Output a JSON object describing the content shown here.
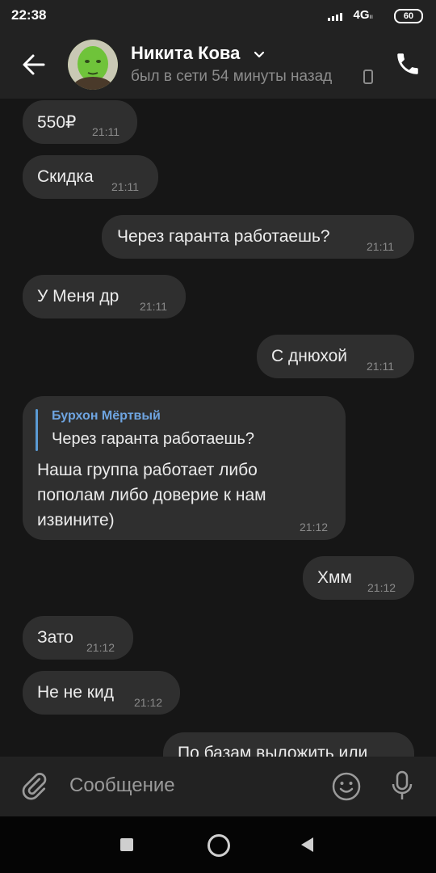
{
  "status_bar": {
    "time": "22:38",
    "network": "4G",
    "network_sub": "ıı",
    "battery": "60"
  },
  "header": {
    "contact_name": "Никита Кова",
    "presence": "был в сети 54 минуты назад"
  },
  "messages": [
    {
      "side": "in",
      "text": "550₽",
      "time": "21:11"
    },
    {
      "side": "in",
      "text": "Скидка",
      "time": "21:11"
    },
    {
      "side": "out",
      "text": "Через гаранта работаешь?",
      "time": "21:11"
    },
    {
      "side": "in",
      "text": "У Меня др",
      "time": "21:11"
    },
    {
      "side": "out",
      "text": "С днюхой",
      "time": "21:11"
    },
    {
      "side": "in",
      "reply_to_author": "Бурхон Мёртвый",
      "reply_to_text": "Через гаранта работаешь?",
      "text_lines": [
        "Наша группа работает либо",
        "пополам либо доверие к нам",
        "извините)"
      ],
      "time": "21:12"
    },
    {
      "side": "out",
      "text": "Хмм",
      "time": "21:12"
    },
    {
      "side": "in",
      "text": "Зато",
      "time": "21:12"
    },
    {
      "side": "in",
      "text": "Не не кид",
      "time": "21:12"
    },
    {
      "side": "out",
      "text": "По базам выложить или",
      "time": ""
    }
  ],
  "composer": {
    "placeholder": "Сообщение"
  },
  "icons": [
    "back-arrow-icon",
    "avatar",
    "chevron-down-icon",
    "phone-device-icon",
    "call-icon",
    "chevron-down-icon",
    "paperclip-icon",
    "emoji-icon",
    "microphone-icon",
    "recent-apps-icon",
    "home-icon",
    "nav-back-icon"
  ],
  "colors": {
    "header_bg": "#222222",
    "chat_bg": "#161616",
    "bubble_bg": "#2f2f2f",
    "reply_accent": "#5b9bd5"
  }
}
